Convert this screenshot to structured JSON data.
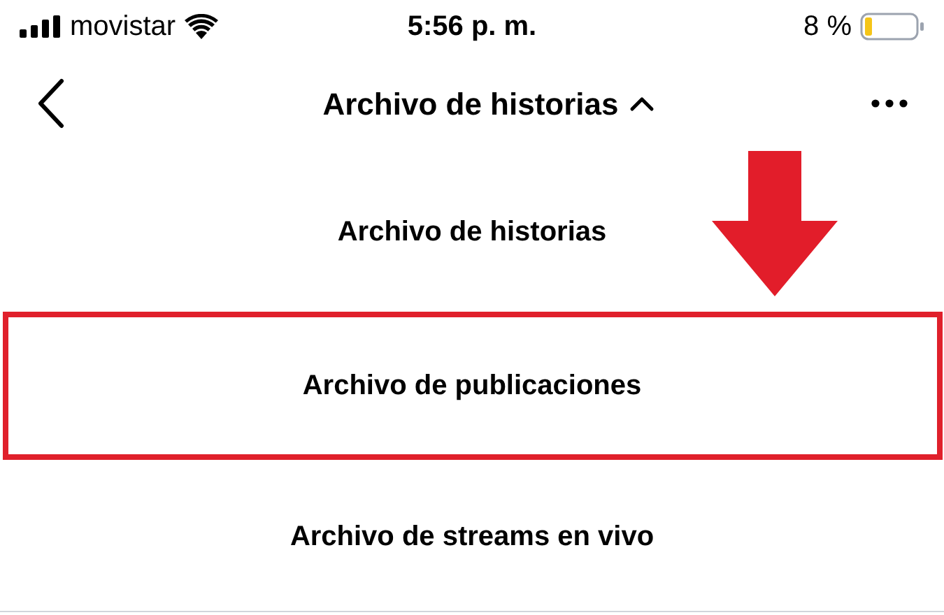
{
  "status_bar": {
    "carrier": "movistar",
    "time": "5:56 p. m.",
    "battery": "8 %"
  },
  "nav": {
    "title": "Archivo de historias",
    "expanded": true
  },
  "menu_items": [
    {
      "label": "Archivo de historias",
      "highlighted": false
    },
    {
      "label": "Archivo de publicaciones",
      "highlighted": true
    },
    {
      "label": "Archivo de streams en vivo",
      "highlighted": false
    }
  ]
}
